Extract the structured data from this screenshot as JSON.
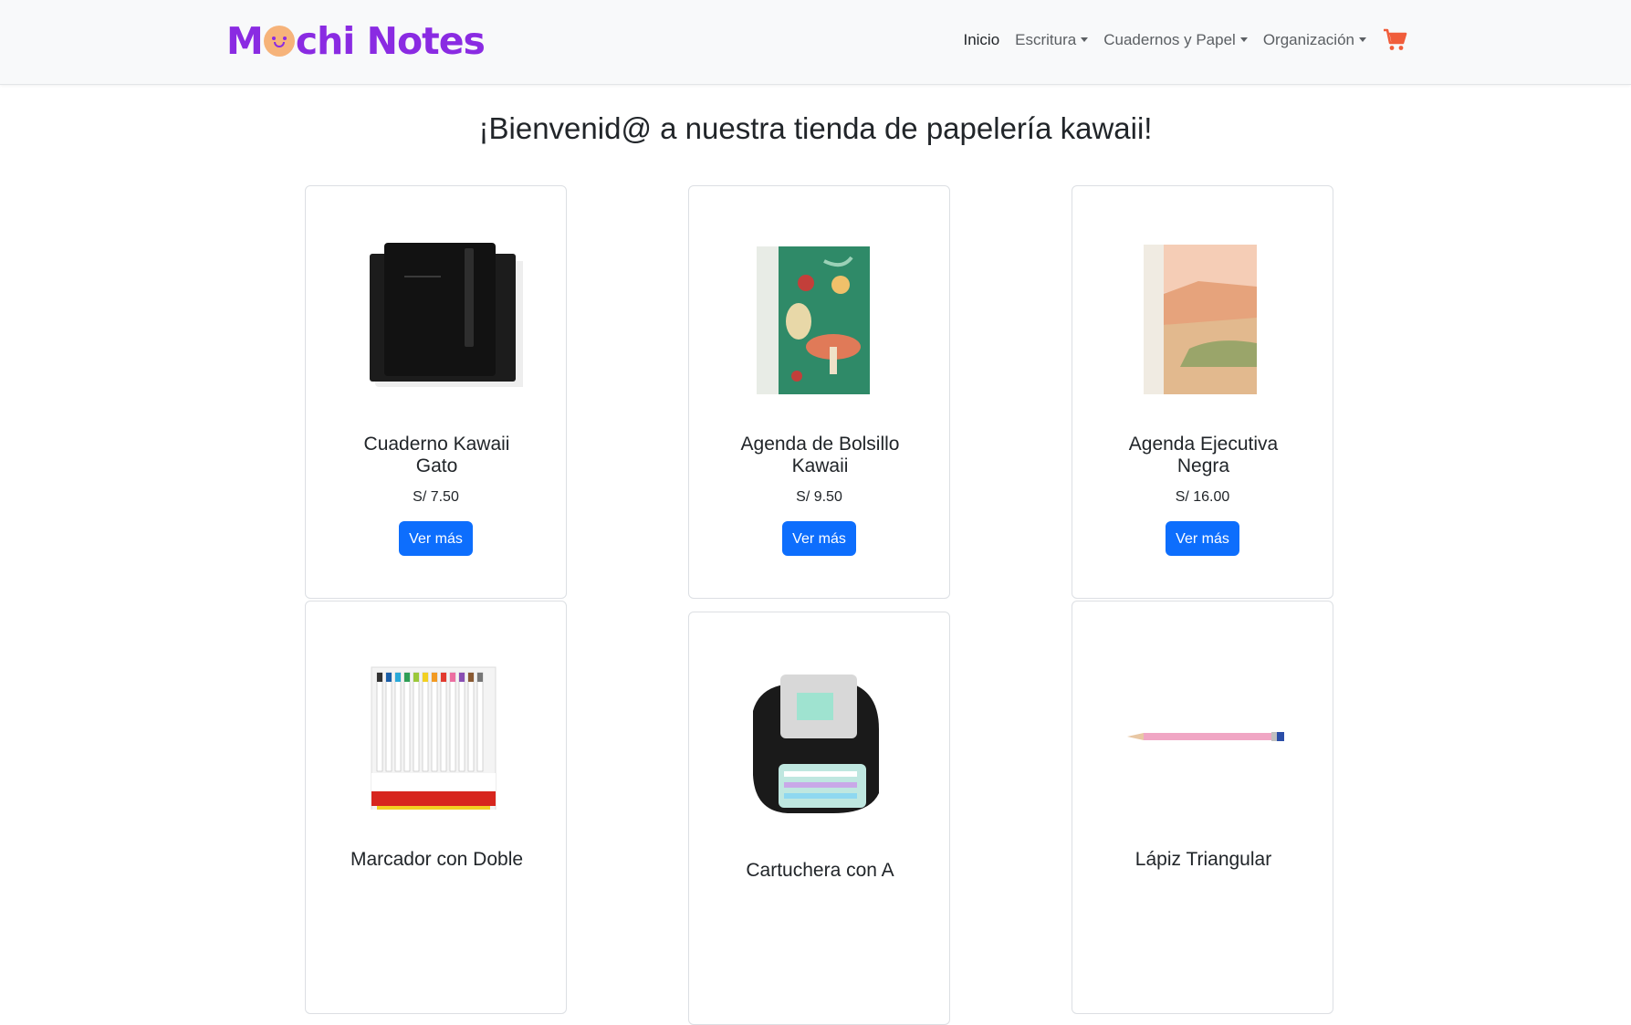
{
  "brand": {
    "name": "Mochi Notes",
    "color": "#8a2be2"
  },
  "nav": {
    "items": [
      {
        "label": "Inicio",
        "active": true
      },
      {
        "label": "Escritura",
        "dropdown": true
      },
      {
        "label": "Cuadernos y Papel",
        "dropdown": true
      },
      {
        "label": "Organización",
        "dropdown": true
      }
    ],
    "cart_icon": "shopping-cart-icon",
    "cart_color": "#f05d3b"
  },
  "main": {
    "heading": "¡Bienvenid@ a nuestra tienda de papelería kawaii!"
  },
  "products": [
    {
      "name": "Cuaderno Kawaii Gato",
      "price": "S/ 7.50",
      "button": "Ver más",
      "image": "black-notebook-image"
    },
    {
      "name": "Agenda de Bolsillo Kawaii",
      "price": "S/ 9.50",
      "button": "Ver más",
      "image": "mushroom-planner-image"
    },
    {
      "name": "Agenda Ejecutiva Negra",
      "price": "S/ 16.00",
      "button": "Ver más",
      "image": "desert-planner-image"
    },
    {
      "name": "Marcador con Doble",
      "image": "clickart-markers-image"
    },
    {
      "name": "Cartuchera con A",
      "image": "pencil-case-image"
    },
    {
      "name": "Lápiz Triangular",
      "image": "pink-pencil-image"
    }
  ],
  "colors": {
    "primary_button": "#0d6efd",
    "navbar_bg": "#f8f9fa"
  }
}
